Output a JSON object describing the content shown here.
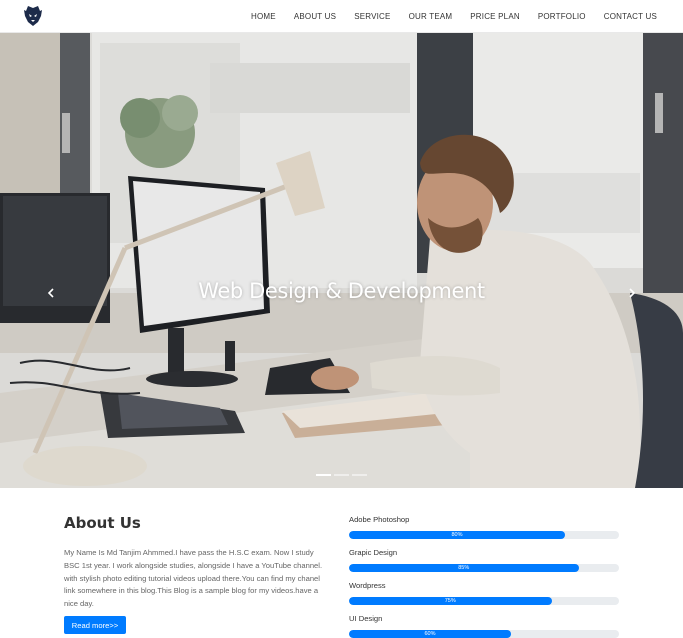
{
  "header": {
    "logo_icon": "mascot-logo-icon",
    "nav": [
      {
        "label": "HOME"
      },
      {
        "label": "ABOUT US"
      },
      {
        "label": "SERVICE"
      },
      {
        "label": "OUR TEAM"
      },
      {
        "label": "PRICE PLAN"
      },
      {
        "label": "PORTFOLIO"
      },
      {
        "label": "CONTACT US"
      }
    ]
  },
  "hero": {
    "title": "Web Design & Development",
    "prev_icon": "chevron-left-icon",
    "next_icon": "chevron-right-icon",
    "slides_count": 3,
    "active_slide": 1
  },
  "about": {
    "title": "About Us",
    "text": "My Name Is Md Tanjim Ahmmed.I have pass the H.S.C exam. Now I study BSC 1st year. I work alongside studies, alongside I have a YouTube channel. with stylish photo editing tutorial videos upload there.You can find my chanel link somewhere in this blog.This Blog is a sample blog for my videos.have a nice day.",
    "button": "Read more>>"
  },
  "skills": [
    {
      "name": "Adobe Photoshop",
      "percent": 80,
      "label": "80%"
    },
    {
      "name": "Grapic Design",
      "percent": 85,
      "label": "85%"
    },
    {
      "name": "Wordpress",
      "percent": 75,
      "label": "75%"
    },
    {
      "name": "UI Design",
      "percent": 60,
      "label": "60%"
    }
  ],
  "colors": {
    "accent": "#007bff",
    "track": "#e9ecef",
    "text": "#333333"
  }
}
